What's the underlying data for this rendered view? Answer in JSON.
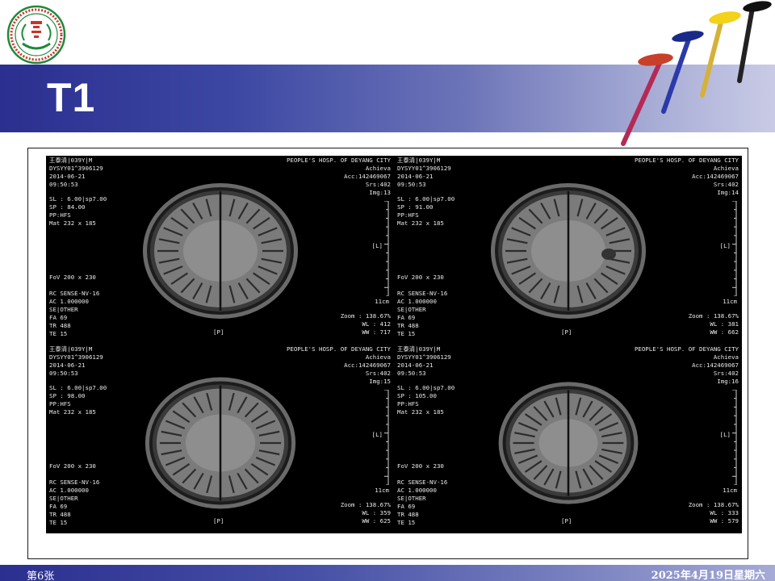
{
  "slide": {
    "title": "T1",
    "slide_number": "第6张",
    "date": "2025年4月19日星期六",
    "logo_text": "德阳市人民医院"
  },
  "colors": {
    "band_dark": "#2b2f8f",
    "band_light": "#c9cbe6",
    "mri_background": "#000000",
    "overlay_text": "#e8e8e8"
  },
  "mri_panels": [
    {
      "patient": "王泰清|039Y|M",
      "id": "DYSYY01^3906129",
      "date": "2014-06-21",
      "time": "09:50:53",
      "hospital": "PEOPLE'S HOSP. OF DEYANG CITY",
      "system": "Achieva",
      "acc": "Acc:142469067",
      "srs": "Srs:402",
      "img": "Img:13",
      "sl": "SL : 6.00|sp7.00",
      "sp": "SP : 84.00",
      "pp": "PP:HFS",
      "mat": "Mat 232 x 185",
      "fov": "FoV 200 x 230",
      "rc": "RC SENSE-NV-16",
      "ac": "AC 1.000000",
      "se": "SE|OTHER",
      "fa": "FA 69",
      "tr": "TR 488",
      "te": "TE 15",
      "zoom": "Zoom : 138.67%",
      "wl": "WL : 412",
      "ww": "WW : 717",
      "orient_l": "[L]",
      "orient_p": "[P]",
      "scale": "11cm"
    },
    {
      "patient": "王泰清|039Y|M",
      "id": "DYSYY01^3906129",
      "date": "2014-06-21",
      "time": "09:50:53",
      "hospital": "PEOPLE'S HOSP. OF DEYANG CITY",
      "system": "Achieva",
      "acc": "Acc:142469067",
      "srs": "Srs:402",
      "img": "Img:14",
      "sl": "SL : 6.00|sp7.00",
      "sp": "SP : 91.00",
      "pp": "PP:HFS",
      "mat": "Mat 232 x 185",
      "fov": "FoV 200 x 230",
      "rc": "RC SENSE-NV-16",
      "ac": "AC 1.000000",
      "se": "SE|OTHER",
      "fa": "FA 69",
      "tr": "TR 488",
      "te": "TE 15",
      "zoom": "Zoom : 138.67%",
      "wl": "WL : 381",
      "ww": "WW : 662",
      "orient_l": "[L]",
      "orient_p": "[P]",
      "scale": "11cm"
    },
    {
      "patient": "王泰清|039Y|M",
      "id": "DYSYY01^3906129",
      "date": "2014-06-21",
      "time": "09:50:53",
      "hospital": "PEOPLE'S HOSP. OF DEYANG CITY",
      "system": "Achieva",
      "acc": "Acc:142469067",
      "srs": "Srs:402",
      "img": "Img:15",
      "sl": "SL : 6.00|sp7.00",
      "sp": "SP : 98.00",
      "pp": "PP:HFS",
      "mat": "Mat 232 x 185",
      "fov": "FoV 200 x 230",
      "rc": "RC SENSE-NV-16",
      "ac": "AC 1.000000",
      "se": "SE|OTHER",
      "fa": "FA 69",
      "tr": "TR 488",
      "te": "TE 15",
      "zoom": "Zoom : 138.67%",
      "wl": "WL : 359",
      "ww": "WW : 625",
      "orient_l": "[L]",
      "orient_p": "[P]",
      "scale": "11cm"
    },
    {
      "patient": "王泰清|039Y|M",
      "id": "DYSYY01^3906129",
      "date": "2014-06-21",
      "time": "09:50:53",
      "hospital": "PEOPLE'S HOSP. OF DEYANG CITY",
      "system": "Achieva",
      "acc": "Acc:142469067",
      "srs": "Srs:402",
      "img": "Img:16",
      "sl": "SL : 6.00|sp7.00",
      "sp": "SP : 105.00",
      "pp": "PP:HFS",
      "mat": "Mat 232 x 185",
      "fov": "FoV 200 x 230",
      "rc": "RC SENSE-NV-16",
      "ac": "AC 1.000000",
      "se": "SE|OTHER",
      "fa": "FA 69",
      "tr": "TR 488",
      "te": "TE 15",
      "zoom": "Zoom : 138.67%",
      "wl": "WL : 333",
      "ww": "WW : 579",
      "orient_l": "[L]",
      "orient_p": "[P]",
      "scale": "11cm"
    }
  ]
}
